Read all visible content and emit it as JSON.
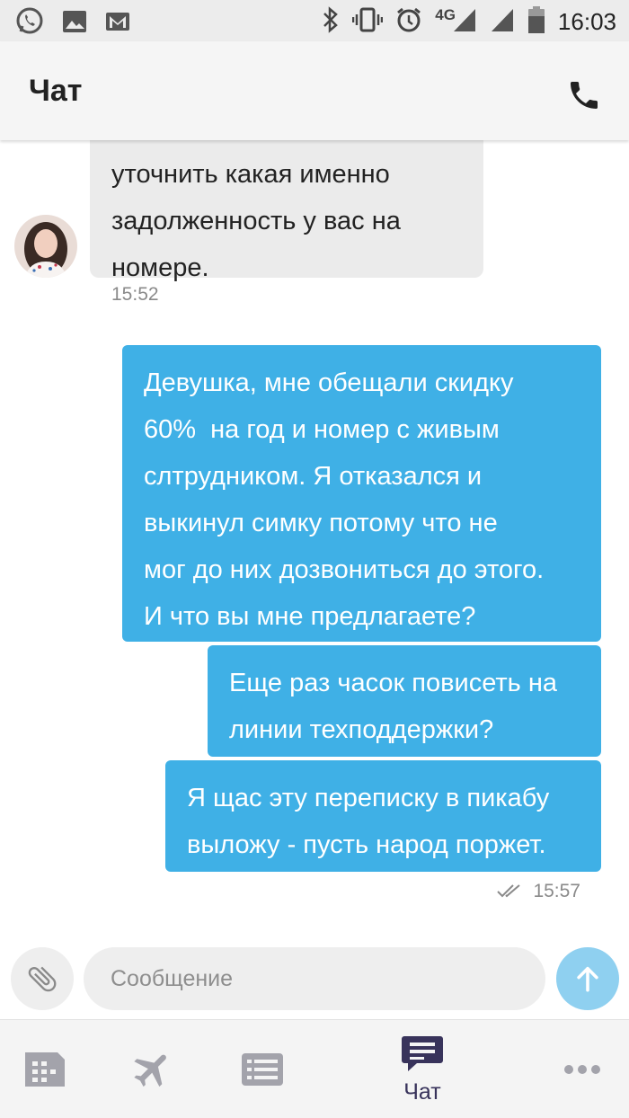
{
  "status_bar": {
    "time": "16:03",
    "network": "4G",
    "left_icons": [
      "viber-icon",
      "image-icon",
      "gmail-icon"
    ],
    "right_icons": [
      "bluetooth-icon",
      "vibrate-icon",
      "alarm-icon",
      "signal-icon",
      "signal-icon",
      "battery-icon"
    ]
  },
  "header": {
    "title": "Чат",
    "call_icon": "phone-icon"
  },
  "messages": {
    "incoming": {
      "lines": [
        "уточнить какая именно",
        "задолженность у вас на",
        "номере."
      ],
      "time": "15:52",
      "avatar": "agent-avatar"
    },
    "outgoing": [
      {
        "lines": [
          "Девушка, мне обещали скидку",
          "60%  на год и номер с живым",
          "слтрудником. Я отказался и",
          "выкинул симку потому что не",
          "мог до них дозвониться до этого.",
          "И что вы мне предлагаете?"
        ]
      },
      {
        "lines": [
          "Еще раз часок повисеть на",
          "линии техподдержки?"
        ]
      },
      {
        "lines": [
          "Я щас эту переписку в пикабу",
          "выложу - пусть народ поржет."
        ]
      }
    ],
    "outgoing_time": "15:57",
    "read_icon": "double-check-icon"
  },
  "composer": {
    "placeholder": "Сообщение",
    "value": "",
    "attach_icon": "paperclip-icon",
    "send_icon": "arrow-up-icon"
  },
  "bottom_nav": {
    "items": [
      {
        "icon": "dashboard-icon",
        "label": ""
      },
      {
        "icon": "airplane-icon",
        "label": ""
      },
      {
        "icon": "list-icon",
        "label": ""
      },
      {
        "icon": "chat-icon",
        "label": "Чат",
        "active": true
      },
      {
        "icon": "more-icon",
        "label": ""
      }
    ]
  },
  "colors": {
    "outgoing_bubble": "#3fb0e6",
    "incoming_bubble": "#ebebeb",
    "send_button": "#8fd0f0",
    "nav_active": "#38335b",
    "nav_inactive": "#a3a3ab"
  }
}
